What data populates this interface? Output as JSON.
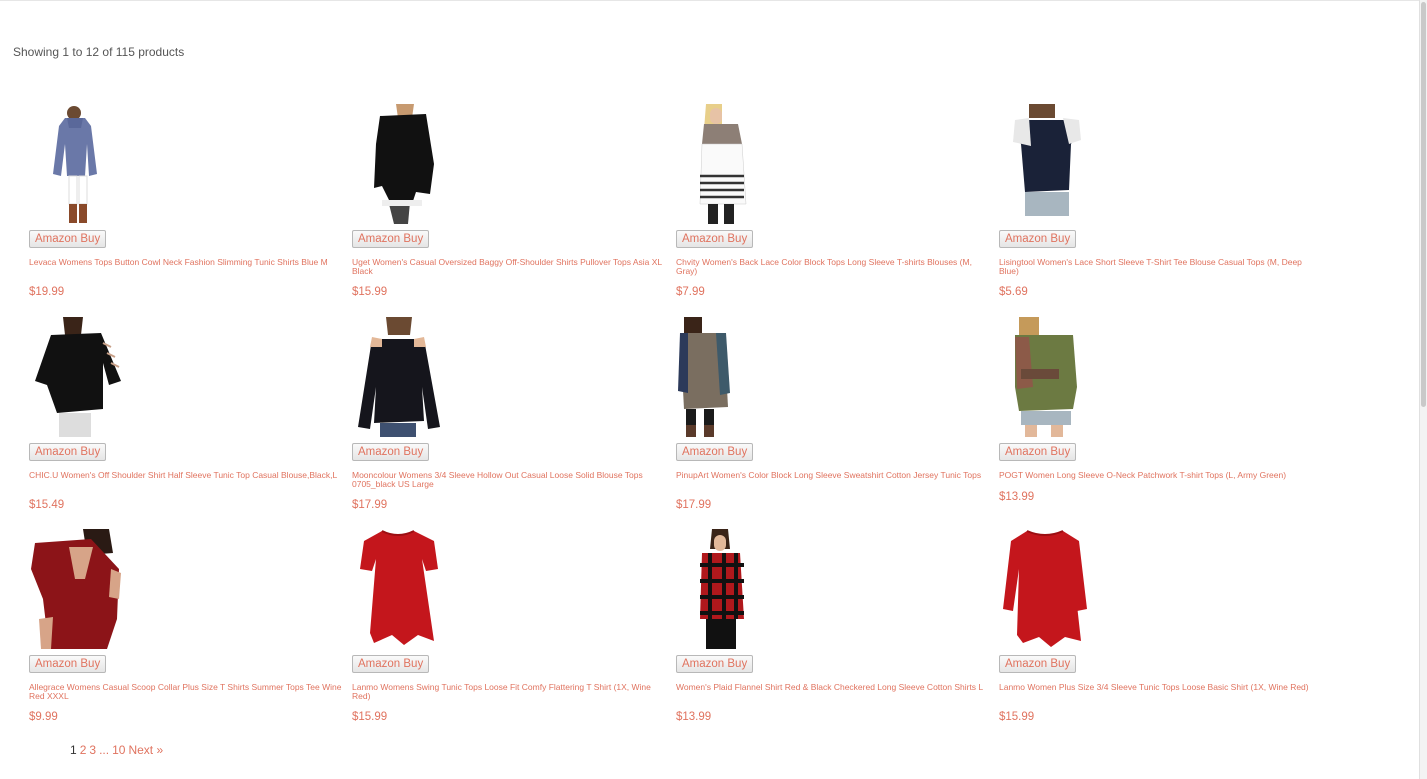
{
  "result_count": "Showing 1 to 12 of 115 products",
  "buy_label": "Amazon Buy",
  "products": [
    {
      "title": "Levaca Womens Tops Button Cowl Neck Fashion Slimming Tunic Shirts Blue M",
      "price": "$19.99"
    },
    {
      "title": "Uget Women's Casual Oversized Baggy Off-Shoulder Shirts Pullover Tops Asia XL Black",
      "price": "$15.99"
    },
    {
      "title": "Chvity Women's Back Lace Color Block Tops Long Sleeve T-shirts Blouses (M, Gray)",
      "price": "$7.99"
    },
    {
      "title": "Lisingtool Women's Lace Short Sleeve T-Shirt Tee Blouse Casual Tops (M, Deep Blue)",
      "price": "$5.69"
    },
    {
      "title": "CHIC.U Women's Off Shoulder Shirt Half Sleeve Tunic Top Casual Blouse,Black,L",
      "price": "$15.49"
    },
    {
      "title": "Mooncolour Womens 3/4 Sleeve Hollow Out Casual Loose Solid Blouse Tops 0705_black US Large",
      "price": "$17.99"
    },
    {
      "title": "PinupArt Women's Color Block Long Sleeve Sweatshirt Cotton Jersey Tunic Tops",
      "price": "$17.99"
    },
    {
      "title": "POGT Women Long Sleeve O-Neck Patchwork T-shirt Tops (L, Army Green)",
      "price": "$13.99"
    },
    {
      "title": "Allegrace Womens Casual Scoop Collar Plus Size T Shirts Summer Tops Tee Wine Red XXXL",
      "price": "$9.99"
    },
    {
      "title": "Lanmo Womens Swing Tunic Tops Loose Fit Comfy Flattering T Shirt (1X, Wine Red)",
      "price": "$15.99"
    },
    {
      "title": "Women's Plaid Flannel Shirt Red & Black Checkered Long Sleeve Cotton Shirts L",
      "price": "$13.99"
    },
    {
      "title": "Lanmo Women Plus Size 3/4 Sleeve Tunic Tops Loose Basic Shirt (1X, Wine Red)",
      "price": "$15.99"
    }
  ],
  "pagination": {
    "p1": "1",
    "p2": "2",
    "p3": "3",
    "ellipsis": "...",
    "p10": "10",
    "next": "Next »"
  },
  "colors": {
    "link": "#e0735f",
    "text": "#555555"
  }
}
